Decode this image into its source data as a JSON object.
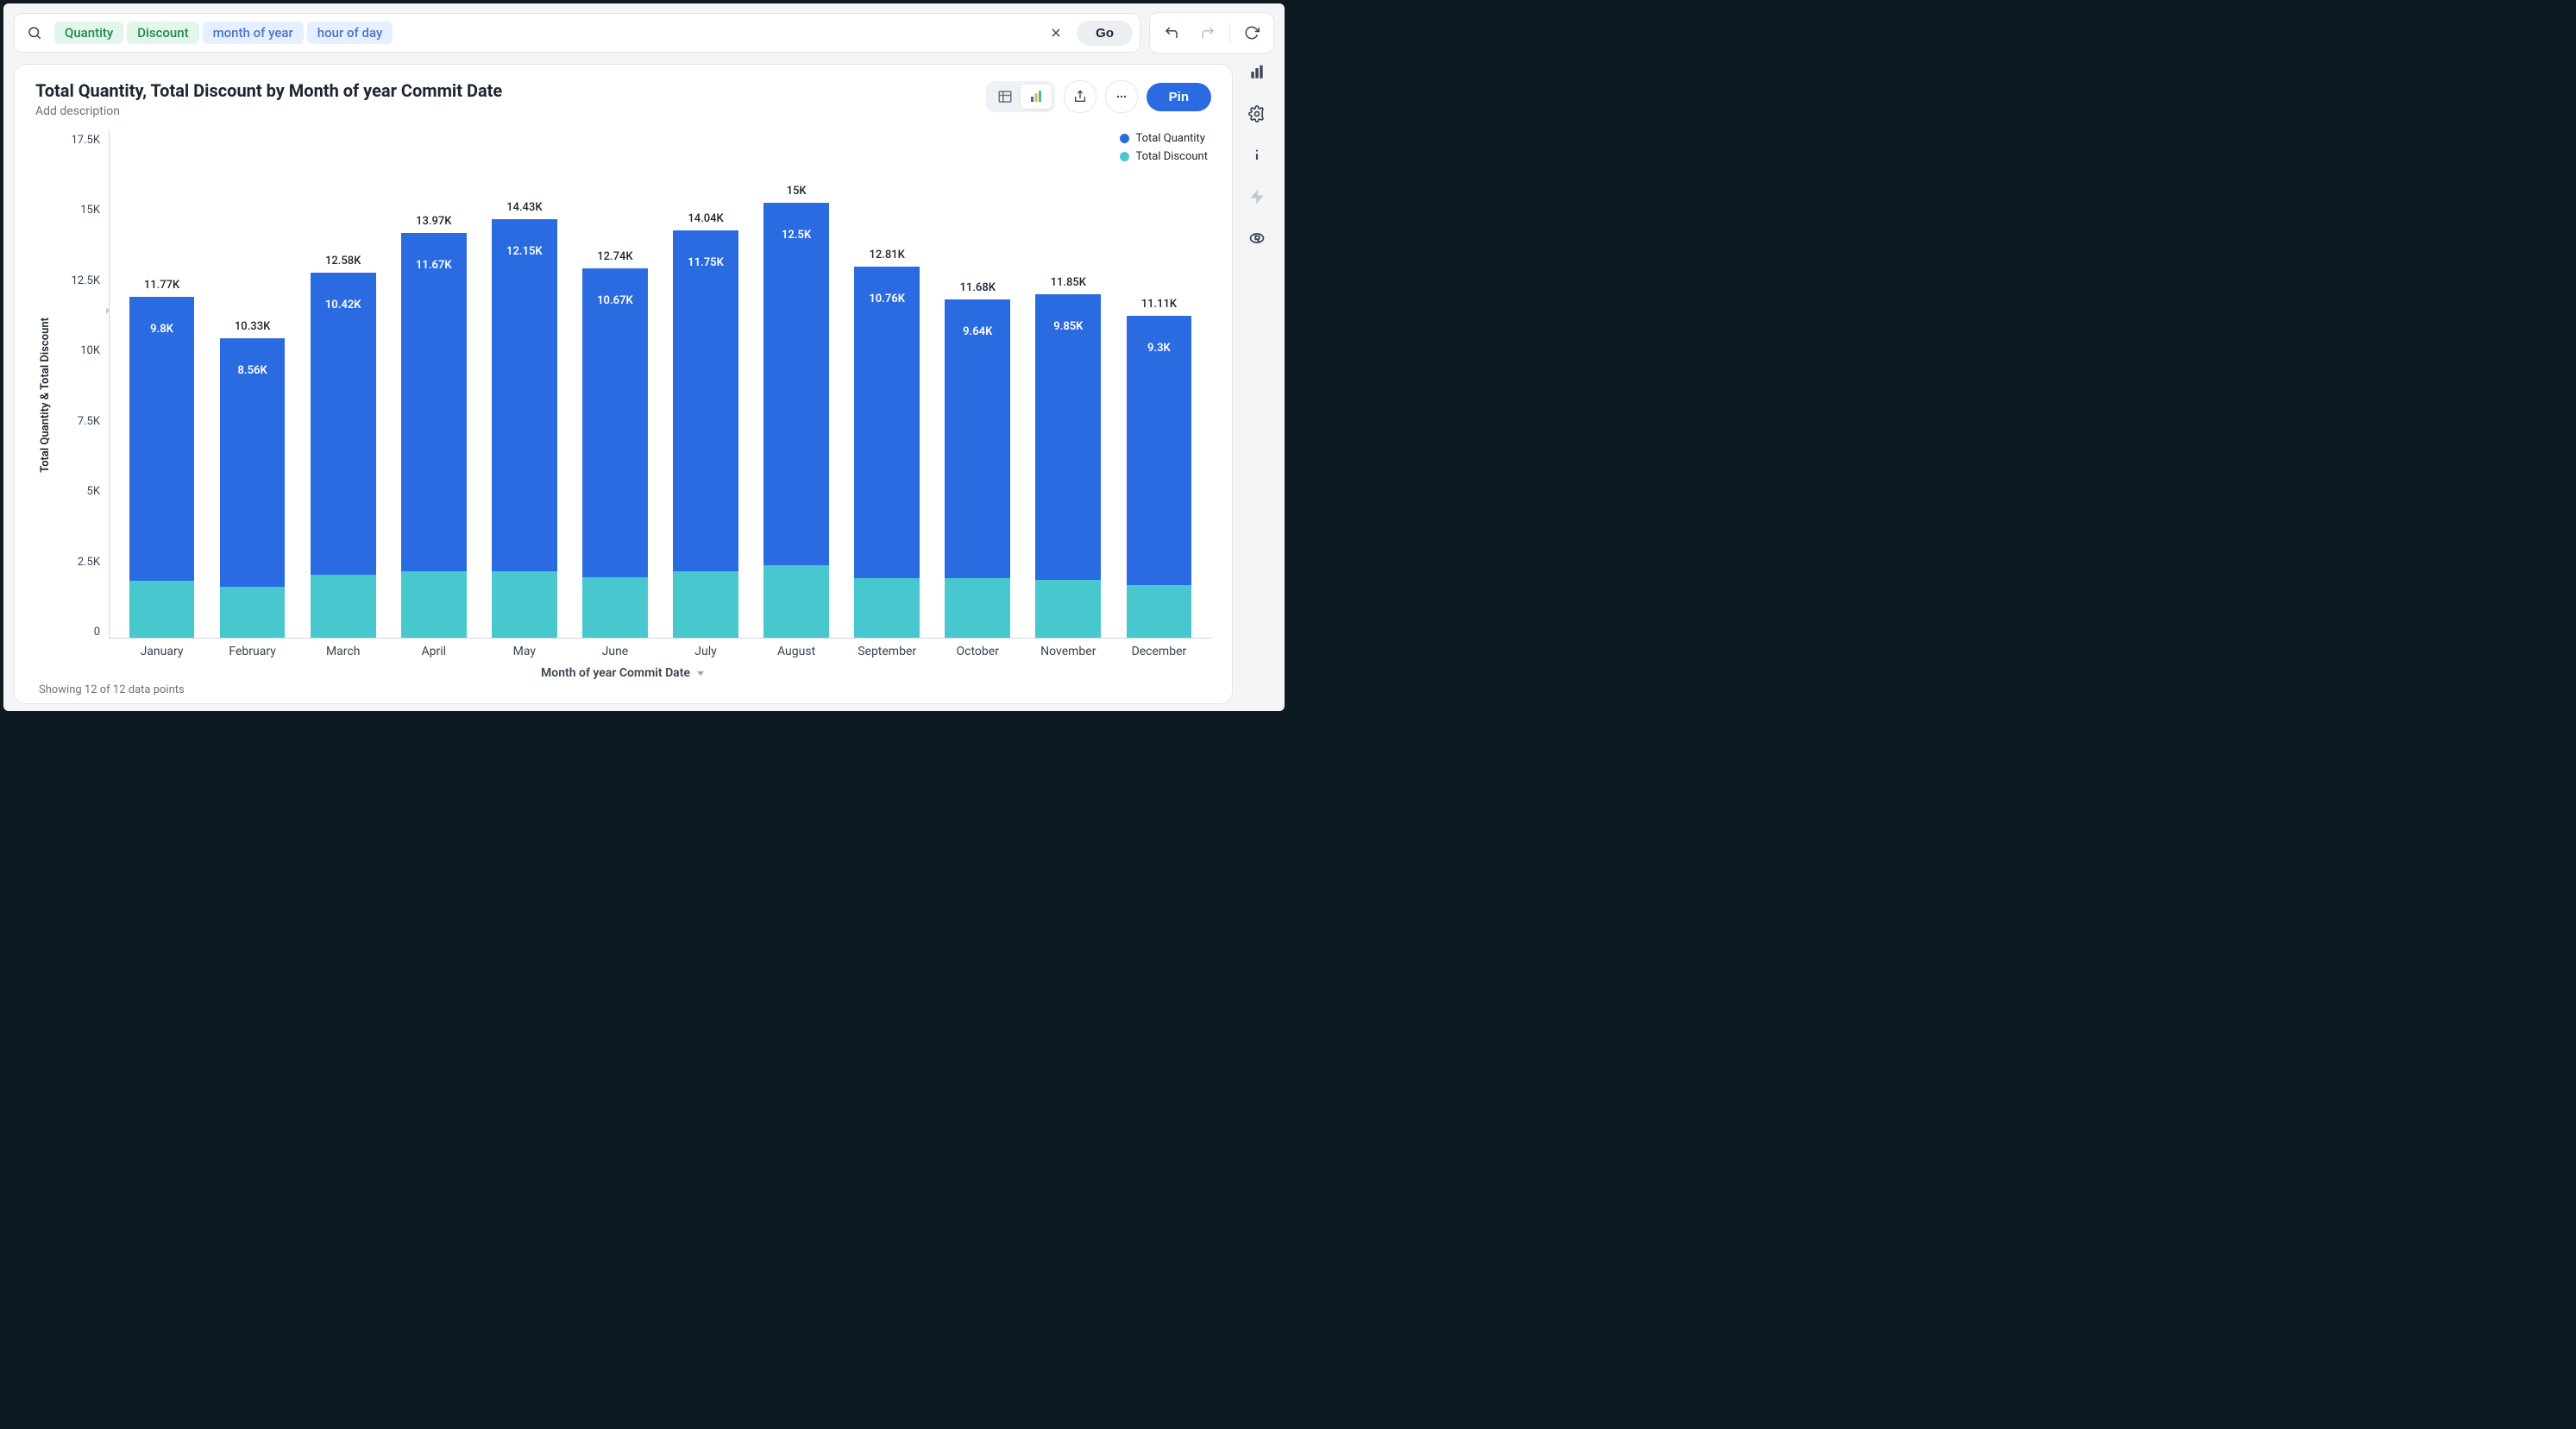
{
  "search": {
    "pills": [
      {
        "label": "Quantity",
        "kind": "green"
      },
      {
        "label": "Discount",
        "kind": "green"
      },
      {
        "label": "month of year",
        "kind": "blue"
      },
      {
        "label": "hour of day",
        "kind": "blue"
      }
    ],
    "go_label": "Go"
  },
  "card": {
    "title": "Total Quantity, Total Discount by Month of year Commit Date",
    "subtitle_placeholder": "Add description",
    "pin_label": "Pin"
  },
  "legend": {
    "series1": "Total Quantity",
    "series2": "Total Discount"
  },
  "axes": {
    "y_title": "Total Quantity & Total Discount",
    "x_title": "Month of year Commit Date",
    "y_ticks": [
      "17.5K",
      "15K",
      "12.5K",
      "10K",
      "7.5K",
      "5K",
      "2.5K",
      "0"
    ],
    "y_max_value": 17.5
  },
  "footer": {
    "note": "Showing 12 of 12 data points"
  },
  "chart_data": {
    "type": "bar",
    "stacked": true,
    "title": "Total Quantity, Total Discount by Month of year Commit Date",
    "xlabel": "Month of year Commit Date",
    "ylabel": "Total Quantity & Total Discount",
    "ylim": [
      0,
      17500
    ],
    "categories": [
      "January",
      "February",
      "March",
      "April",
      "May",
      "June",
      "July",
      "August",
      "September",
      "October",
      "November",
      "December"
    ],
    "series": [
      {
        "name": "Total Quantity",
        "color": "#2a6be2",
        "values": [
          9800,
          8560,
          10420,
          11670,
          12150,
          10670,
          11750,
          12500,
          10760,
          9640,
          9850,
          9300
        ],
        "labels": [
          "9.8K",
          "8.56K",
          "10.42K",
          "11.67K",
          "12.15K",
          "10.67K",
          "11.75K",
          "12.5K",
          "10.76K",
          "9.64K",
          "9.85K",
          "9.3K"
        ]
      },
      {
        "name": "Total Discount",
        "color": "#48c8ce",
        "values": [
          1970,
          1770,
          2160,
          2300,
          2280,
          2070,
          2290,
          2500,
          2050,
          2040,
          2000,
          1810
        ]
      }
    ],
    "stack_totals": [
      11770,
      10330,
      12580,
      13970,
      14430,
      12740,
      14040,
      15000,
      12810,
      11680,
      11850,
      11110
    ],
    "stack_total_labels": [
      "11.77K",
      "10.33K",
      "12.58K",
      "13.97K",
      "14.43K",
      "12.74K",
      "14.04K",
      "15K",
      "12.81K",
      "11.68K",
      "11.85K",
      "11.11K"
    ]
  }
}
